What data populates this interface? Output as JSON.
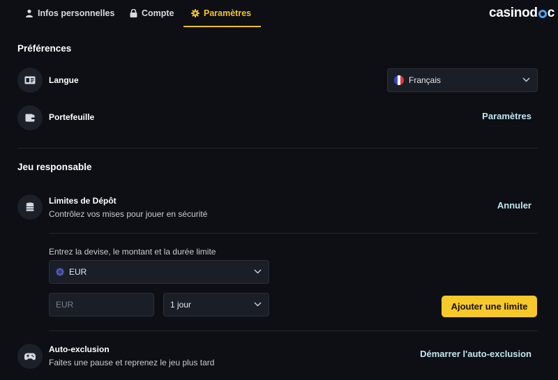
{
  "tabs": [
    {
      "label": "Infos personnelles",
      "icon": "user-icon",
      "active": false
    },
    {
      "label": "Compte",
      "icon": "lock-icon",
      "active": false
    },
    {
      "label": "Paramètres",
      "icon": "gear-icon",
      "active": true
    }
  ],
  "logo": {
    "prefix": "casinod",
    "suffix": "c"
  },
  "colors": {
    "accent": "#f5c12c",
    "link": "#bfe6f2",
    "background": "#0d0f15",
    "button": "#f7c82a"
  },
  "preferences": {
    "title": "Préférences",
    "language": {
      "label": "Langue",
      "icon": "language-card-icon",
      "value": "Français",
      "flag": "france-flag-icon"
    },
    "wallet": {
      "label": "Portefeuille",
      "icon": "wallet-icon",
      "action": "Paramètres"
    }
  },
  "responsible": {
    "title": "Jeu responsable",
    "deposit": {
      "label": "Limites de Dépôt",
      "description": "Contrôlez vos mises pour jouer en sécurité",
      "icon": "coins-stack-icon",
      "action": "Annuler",
      "form": {
        "instruction": "Entrez la devise, le montant et la durée limite",
        "currency": "EUR",
        "currency_icon": "euro-stars-icon",
        "amount_placeholder": "EUR",
        "period": "1 jour",
        "submit": "Ajouter une limite"
      }
    },
    "self_exclusion": {
      "label": "Auto-exclusion",
      "description": "Faites une pause et reprenez le jeu plus tard",
      "icon": "gamepad-icon",
      "action": "Démarrer l'auto-exclusion"
    }
  }
}
